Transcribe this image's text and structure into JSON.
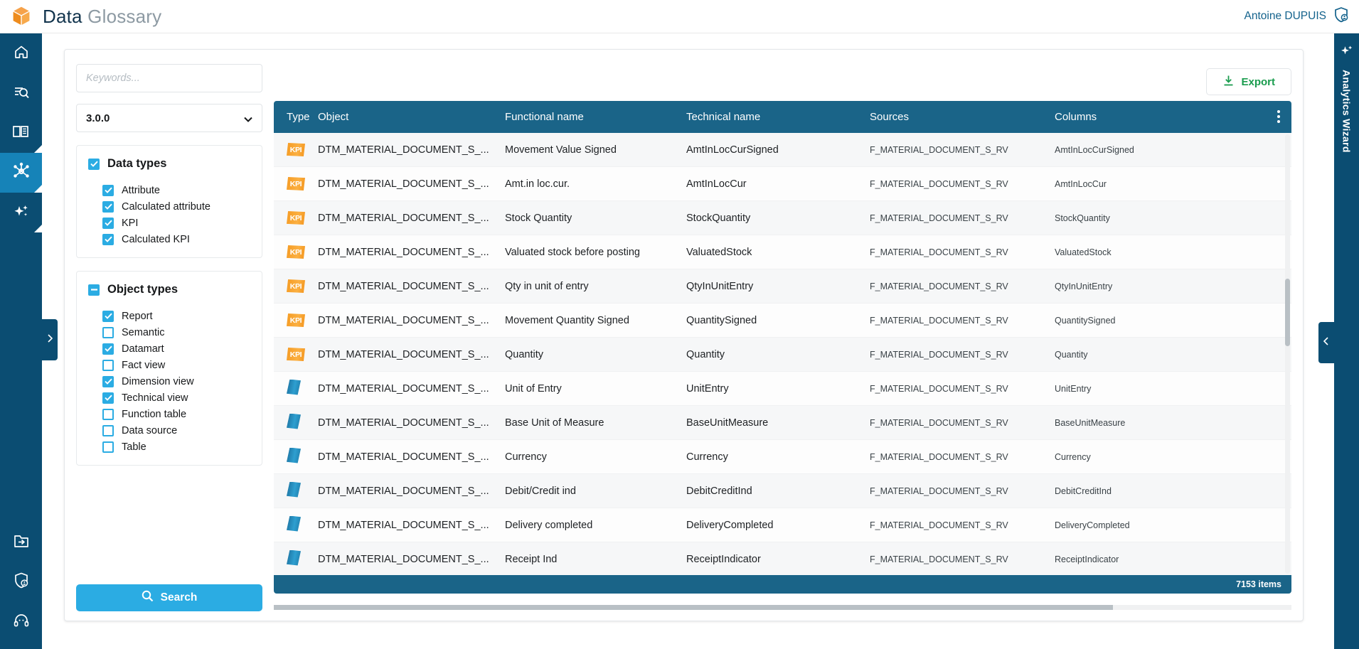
{
  "header": {
    "logo_icon": "cube-logo-icon",
    "title_part1": "Data",
    "title_part2": "Glossary",
    "user_name": "Antoine DUPUIS",
    "user_icon": "shield-user-icon"
  },
  "sidebar": {
    "items": [
      {
        "name": "home",
        "icon": "home-icon",
        "active": false
      },
      {
        "name": "search-list",
        "icon": "search-list-icon",
        "active": false
      },
      {
        "name": "dictionary",
        "icon": "book-icon",
        "active": false
      },
      {
        "name": "glossary-graph",
        "icon": "network-nodes-icon",
        "active": true
      },
      {
        "name": "insights",
        "icon": "sparkles-icon",
        "active": false
      }
    ],
    "bottom_items": [
      {
        "name": "import",
        "icon": "folder-import-icon"
      },
      {
        "name": "security",
        "icon": "shield-lock-icon"
      },
      {
        "name": "support",
        "icon": "headset-icon"
      }
    ]
  },
  "filters": {
    "keywords": {
      "value": "",
      "placeholder": "Keywords..."
    },
    "version_select": {
      "value": "3.0.0",
      "caret_icon": "chevron-down-icon"
    },
    "data_types": {
      "group_label": "Data types",
      "group_state": "checked",
      "items": [
        {
          "label": "Attribute",
          "state": "checked"
        },
        {
          "label": "Calculated attribute",
          "state": "checked"
        },
        {
          "label": "KPI",
          "state": "checked"
        },
        {
          "label": "Calculated KPI",
          "state": "checked"
        }
      ]
    },
    "object_types": {
      "group_label": "Object types",
      "group_state": "indeterminate",
      "items": [
        {
          "label": "Report",
          "state": "checked"
        },
        {
          "label": "Semantic",
          "state": "unchecked"
        },
        {
          "label": "Datamart",
          "state": "checked"
        },
        {
          "label": "Fact view",
          "state": "unchecked"
        },
        {
          "label": "Dimension view",
          "state": "checked"
        },
        {
          "label": "Technical view",
          "state": "checked"
        },
        {
          "label": "Function table",
          "state": "unchecked"
        },
        {
          "label": "Data source",
          "state": "unchecked"
        },
        {
          "label": "Table",
          "state": "unchecked"
        }
      ]
    },
    "search_button": {
      "label": "Search",
      "icon": "magnifier-icon"
    }
  },
  "toolbar": {
    "export_label": "Export",
    "export_icon": "download-icon"
  },
  "table": {
    "columns": [
      "Type",
      "Object",
      "Functional name",
      "Technical name",
      "Sources",
      "Columns"
    ],
    "menu_icon": "kebab-menu-icon",
    "rows": [
      {
        "type": "attribute",
        "object": "DTM_MATERIAL_DOCUMENT_S_...",
        "functional": "Receipt Ind",
        "technical": "ReceiptIndicator",
        "sources": "F_MATERIAL_DOCUMENT_S_RV",
        "columns": "ReceiptIndicator"
      },
      {
        "type": "attribute",
        "object": "DTM_MATERIAL_DOCUMENT_S_...",
        "functional": "Delivery completed",
        "technical": "DeliveryCompleted",
        "sources": "F_MATERIAL_DOCUMENT_S_RV",
        "columns": "DeliveryCompleted"
      },
      {
        "type": "attribute",
        "object": "DTM_MATERIAL_DOCUMENT_S_...",
        "functional": "Debit/Credit ind",
        "technical": "DebitCreditInd",
        "sources": "F_MATERIAL_DOCUMENT_S_RV",
        "columns": "DebitCreditInd"
      },
      {
        "type": "attribute",
        "object": "DTM_MATERIAL_DOCUMENT_S_...",
        "functional": "Currency",
        "technical": "Currency",
        "sources": "F_MATERIAL_DOCUMENT_S_RV",
        "columns": "Currency"
      },
      {
        "type": "attribute",
        "object": "DTM_MATERIAL_DOCUMENT_S_...",
        "functional": "Base Unit of Measure",
        "technical": "BaseUnitMeasure",
        "sources": "F_MATERIAL_DOCUMENT_S_RV",
        "columns": "BaseUnitMeasure"
      },
      {
        "type": "attribute",
        "object": "DTM_MATERIAL_DOCUMENT_S_...",
        "functional": "Unit of Entry",
        "technical": "UnitEntry",
        "sources": "F_MATERIAL_DOCUMENT_S_RV",
        "columns": "UnitEntry"
      },
      {
        "type": "kpi",
        "object": "DTM_MATERIAL_DOCUMENT_S_...",
        "functional": "Quantity",
        "technical": "Quantity",
        "sources": "F_MATERIAL_DOCUMENT_S_RV",
        "columns": "Quantity"
      },
      {
        "type": "kpi",
        "object": "DTM_MATERIAL_DOCUMENT_S_...",
        "functional": "Movement Quantity Signed",
        "technical": "QuantitySigned",
        "sources": "F_MATERIAL_DOCUMENT_S_RV",
        "columns": "QuantitySigned"
      },
      {
        "type": "kpi",
        "object": "DTM_MATERIAL_DOCUMENT_S_...",
        "functional": "Qty in unit of entry",
        "technical": "QtyInUnitEntry",
        "sources": "F_MATERIAL_DOCUMENT_S_RV",
        "columns": "QtyInUnitEntry"
      },
      {
        "type": "kpi",
        "object": "DTM_MATERIAL_DOCUMENT_S_...",
        "functional": "Valuated stock before posting",
        "technical": "ValuatedStock",
        "sources": "F_MATERIAL_DOCUMENT_S_RV",
        "columns": "ValuatedStock"
      },
      {
        "type": "kpi",
        "object": "DTM_MATERIAL_DOCUMENT_S_...",
        "functional": "Stock Quantity",
        "technical": "StockQuantity",
        "sources": "F_MATERIAL_DOCUMENT_S_RV",
        "columns": "StockQuantity"
      },
      {
        "type": "kpi",
        "object": "DTM_MATERIAL_DOCUMENT_S_...",
        "functional": "Amt.in loc.cur.",
        "technical": "AmtInLocCur",
        "sources": "F_MATERIAL_DOCUMENT_S_RV",
        "columns": "AmtInLocCur"
      },
      {
        "type": "kpi",
        "object": "DTM_MATERIAL_DOCUMENT_S_...",
        "functional": "Movement Value Signed",
        "technical": "AmtInLocCurSigned",
        "sources": "F_MATERIAL_DOCUMENT_S_RV",
        "columns": "AmtInLocCurSigned"
      }
    ],
    "footer_count": "7153 items",
    "kpi_icon_label": "KPI"
  },
  "wizard": {
    "label": "Analytics Wizard",
    "icon": "sparkles-icon",
    "collapse_icon": "chevron-left-icon",
    "expand_icon": "chevron-right-icon"
  },
  "colors": {
    "rail": "#0b4d72",
    "rail_active": "#1683b8",
    "table_header": "#1a6488",
    "accent_cyan": "#2bace3",
    "export_green": "#1a9c4e",
    "logo_orange": "#f08a22"
  }
}
